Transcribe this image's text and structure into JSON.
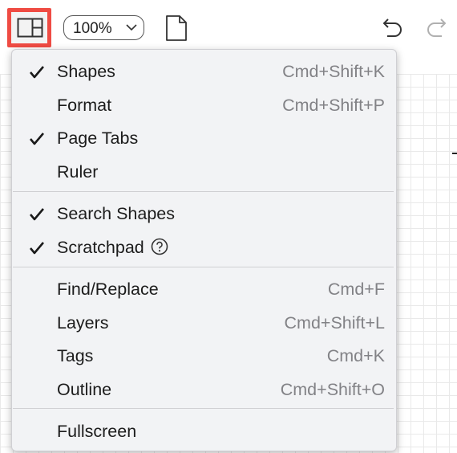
{
  "toolbar": {
    "zoom_label": "100%",
    "icons": [
      "panel-layout-icon",
      "chevron-down-icon",
      "page-icon",
      "undo-icon",
      "redo-icon"
    ]
  },
  "menu": {
    "items": [
      {
        "label": "Shapes",
        "shortcut": "Cmd+Shift+K",
        "checked": true
      },
      {
        "label": "Format",
        "shortcut": "Cmd+Shift+P",
        "checked": false
      },
      {
        "label": "Page Tabs",
        "shortcut": "",
        "checked": true
      },
      {
        "label": "Ruler",
        "shortcut": "",
        "checked": false
      },
      {
        "label": "Search Shapes",
        "shortcut": "",
        "checked": true
      },
      {
        "label": "Scratchpad",
        "shortcut": "",
        "checked": true,
        "help_icon": "help-circle-icon"
      },
      {
        "label": "Find/Replace",
        "shortcut": "Cmd+F",
        "checked": false
      },
      {
        "label": "Layers",
        "shortcut": "Cmd+Shift+L",
        "checked": false
      },
      {
        "label": "Tags",
        "shortcut": "Cmd+K",
        "checked": false
      },
      {
        "label": "Outline",
        "shortcut": "Cmd+Shift+O",
        "checked": false
      },
      {
        "label": "Fullscreen",
        "shortcut": "",
        "checked": false
      }
    ]
  },
  "colors": {
    "highlight": "#ef4b43",
    "menu_bg": "#f2f3f5",
    "shortcut_text": "#828286"
  }
}
